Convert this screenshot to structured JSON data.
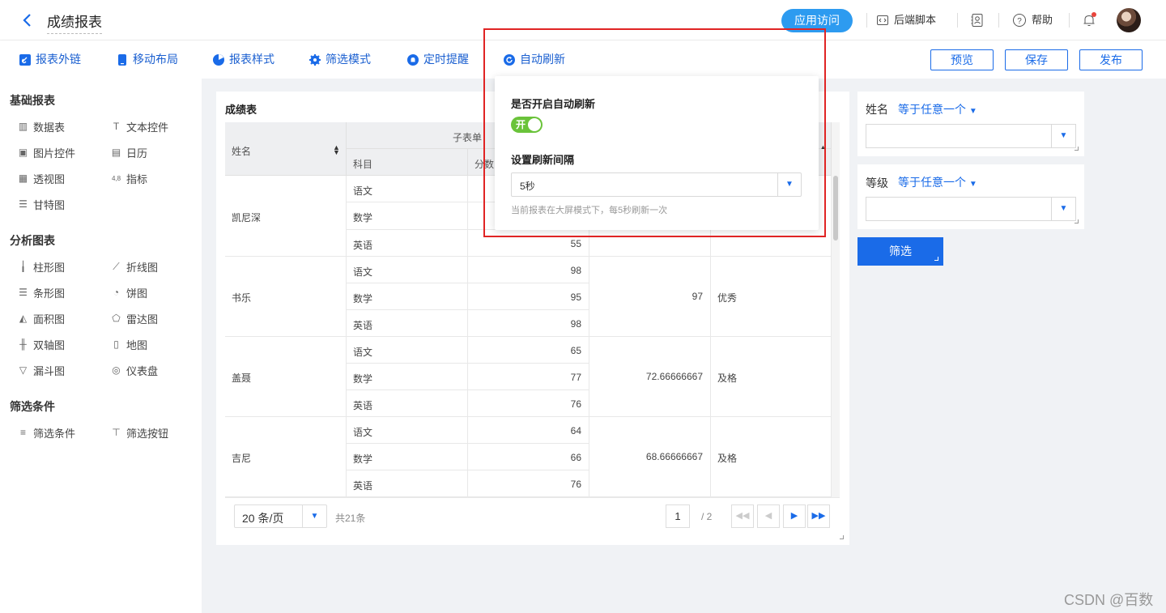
{
  "header": {
    "title": "成绩报表",
    "visit_label": "应用访问",
    "script_label": "后端脚本",
    "help_label": "帮助"
  },
  "toolbar": {
    "items": [
      {
        "label": "报表外链",
        "icon": "link-icon"
      },
      {
        "label": "移动布局",
        "icon": "mobile-icon"
      },
      {
        "label": "报表样式",
        "icon": "style-icon"
      },
      {
        "label": "筛选模式",
        "icon": "gear-icon"
      },
      {
        "label": "定时提醒",
        "icon": "bell-icon"
      },
      {
        "label": "自动刷新",
        "icon": "refresh-icon"
      }
    ],
    "preview_label": "预览",
    "save_label": "保存",
    "publish_label": "发布"
  },
  "sidebar": {
    "sections": [
      {
        "title": "基础报表",
        "items": [
          "数据表",
          "文本控件",
          "图片控件",
          "日历",
          "透视图",
          "指标",
          "甘特图"
        ]
      },
      {
        "title": "分析图表",
        "items": [
          "柱形图",
          "折线图",
          "条形图",
          "饼图",
          "面积图",
          "雷达图",
          "双轴图",
          "地图",
          "漏斗图",
          "仪表盘"
        ]
      },
      {
        "title": "筛选条件",
        "items": [
          "筛选条件",
          "筛选按钮"
        ]
      }
    ]
  },
  "report": {
    "title": "成绩表",
    "columns": {
      "name": "姓名",
      "group": "子表单",
      "subject": "科目",
      "score": "分数"
    },
    "rows": [
      {
        "name": "凯尼深",
        "subjects": [
          {
            "subject": "语文",
            "score": ""
          },
          {
            "subject": "数学",
            "score": ""
          },
          {
            "subject": "英语",
            "score": "55"
          }
        ],
        "avg": "",
        "grade": ""
      },
      {
        "name": "书乐",
        "subjects": [
          {
            "subject": "语文",
            "score": "98"
          },
          {
            "subject": "数学",
            "score": "95"
          },
          {
            "subject": "英语",
            "score": "98"
          }
        ],
        "avg": "97",
        "grade": "优秀"
      },
      {
        "name": "盖聂",
        "subjects": [
          {
            "subject": "语文",
            "score": "65"
          },
          {
            "subject": "数学",
            "score": "77"
          },
          {
            "subject": "英语",
            "score": "76"
          }
        ],
        "avg": "72.66666667",
        "grade": "及格"
      },
      {
        "name": "吉尼",
        "subjects": [
          {
            "subject": "语文",
            "score": "64"
          },
          {
            "subject": "数学",
            "score": "66"
          },
          {
            "subject": "英语",
            "score": "76"
          }
        ],
        "avg": "68.66666667",
        "grade": "及格"
      }
    ],
    "pagination": {
      "page_size": "20 条/页",
      "total": "共21条",
      "current": "1",
      "total_pages": "/ 2"
    }
  },
  "filters": {
    "name_label": "姓名",
    "name_cond": "等于任意一个",
    "grade_label": "等级",
    "grade_cond": "等于任意一个",
    "filter_button": "筛选"
  },
  "popover": {
    "enable_label": "是否开启自动刷新",
    "toggle_text": "开",
    "interval_label": "设置刷新间隔",
    "interval_value": "5秒",
    "hint": "当前报表在大屏模式下，每5秒刷新一次"
  },
  "watermark": "CSDN @百数"
}
